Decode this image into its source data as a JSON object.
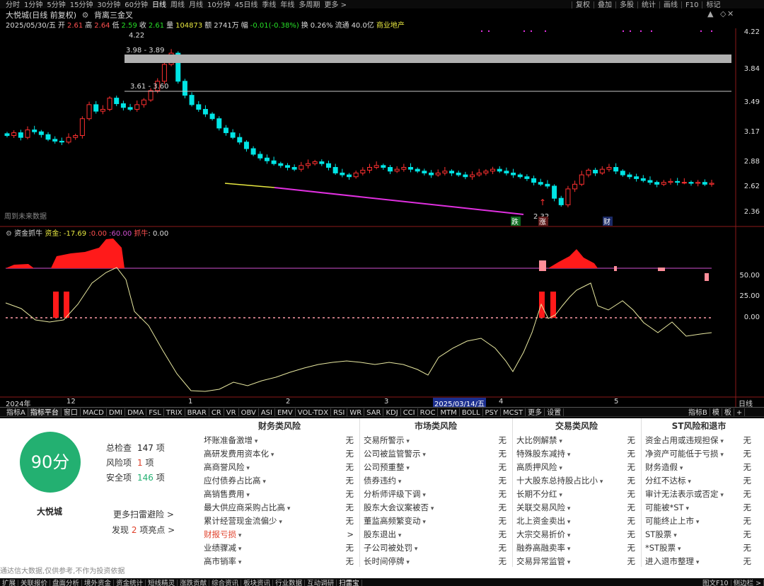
{
  "topbar": {
    "periods": [
      "分时",
      "1分钟",
      "5分钟",
      "15分钟",
      "30分钟",
      "60分钟",
      "日线",
      "周线",
      "月线",
      "10分钟",
      "45日线",
      "季线",
      "年线",
      "多周期",
      "更多 >"
    ],
    "active": "日线",
    "right_tools": [
      "复权",
      "叠加",
      "多股",
      "统计",
      "画线",
      "F10",
      "标记"
    ]
  },
  "header": {
    "stock": "大悦城(日线 前复权)",
    "mode_icon": "gear-icon",
    "strategy": "背离三金叉",
    "date": "2025/05/30/五",
    "open_label": "开",
    "open": "2.61",
    "high_label": "高",
    "high": "2.64",
    "low_label": "低",
    "low": "2.59",
    "close_label": "收",
    "close": "2.61",
    "volume_label": "量",
    "volume": "104873",
    "amount_label": "额",
    "amount": "2741万",
    "change_label": "幅",
    "change": "-0.01(-0.38%)",
    "turnover_label": "换",
    "turnover": "0.26%",
    "float_label": "流通",
    "float": "40.0亿",
    "sector": "商业地产"
  },
  "price_axis": {
    "labels": [
      "4.22",
      "3.84",
      "3.49",
      "3.17",
      "2.88",
      "2.62",
      "2.36"
    ]
  },
  "chart_data": {
    "type": "candlestick",
    "title": "大悦城(日线 前复权)",
    "x_month_labels": [
      "2024年",
      "12",
      "1",
      "2",
      "3",
      "2025/03/14/五",
      "4",
      "5"
    ],
    "price_ylim": [
      2.25,
      4.3
    ],
    "high_mark": "4.22",
    "low_mark": "2.32",
    "annotations": [
      "3.98 - 3.89",
      "3.61 - 3.60"
    ],
    "events": [
      "跌",
      "涨",
      "财"
    ],
    "footnote": "周到未来数据",
    "indicator": {
      "name": "资金抓牛",
      "fund_label": "资金",
      "fund_value": "-17.69",
      "level_a": "0.00",
      "level_b": "60.00",
      "bull_label": "抓牛",
      "bull_value": "0.00",
      "axis_labels": [
        "50.00",
        "25.00",
        "0.00"
      ]
    }
  },
  "tabs": {
    "items": [
      "指标A",
      "指标平台",
      "窗口",
      "MACD",
      "DMI",
      "DMA",
      "FSL",
      "TRIX",
      "BRAR",
      "CR",
      "VR",
      "OBV",
      "ASI",
      "EMV",
      "VOL-TDX",
      "RSI",
      "WR",
      "SAR",
      "KDJ",
      "CCI",
      "ROC",
      "MTM",
      "BOLL",
      "PSY",
      "MCST",
      "更多",
      "设置"
    ],
    "right": [
      "指标B",
      "模",
      "板",
      "+"
    ]
  },
  "panel": {
    "score": "90分",
    "company": "大悦城",
    "total_label": "总检查",
    "total": "147",
    "unit": "项",
    "risk_label": "风险项",
    "risk": "1",
    "safe_label": "安全项",
    "safe": "146",
    "more_link": "更多扫雷避险 >",
    "found_prefix": "发现",
    "found": "2",
    "found_suffix": "项亮点 >",
    "disclaimer": "通达信大数据,仅供参考,不作为投资依据",
    "columns": [
      {
        "title": "财务类风险",
        "rows": [
          {
            "label": "坏账准备激增",
            "value": "无"
          },
          {
            "label": "高研发费用资本化",
            "value": "无"
          },
          {
            "label": "高商誉风险",
            "value": "无"
          },
          {
            "label": "应付债券占比高",
            "value": "无"
          },
          {
            "label": "高销售费用",
            "value": "无"
          },
          {
            "label": "最大供应商采购占比高",
            "value": "无"
          },
          {
            "label": "累计经营现金流偏少",
            "value": "无"
          },
          {
            "label": "财报亏损",
            "value": ">",
            "warn": true
          },
          {
            "label": "业绩骤减",
            "value": "无"
          },
          {
            "label": "高市销率",
            "value": "无"
          }
        ]
      },
      {
        "title": "市场类风险",
        "rows": [
          {
            "label": "交易所警示",
            "value": "无"
          },
          {
            "label": "公司被监管警示",
            "value": "无"
          },
          {
            "label": "公司预重整",
            "value": "无"
          },
          {
            "label": "债券违约",
            "value": "无"
          },
          {
            "label": "分析师评级下调",
            "value": "无"
          },
          {
            "label": "股东大会议案被否",
            "value": "无"
          },
          {
            "label": "董监高频繁变动",
            "value": "无"
          },
          {
            "label": "股东退出",
            "value": "无"
          },
          {
            "label": "子公司被处罚",
            "value": "无"
          },
          {
            "label": "长时间停牌",
            "value": "无"
          }
        ]
      },
      {
        "title": "交易类风险",
        "rows": [
          {
            "label": "大比例解禁",
            "value": "无"
          },
          {
            "label": "特殊股东减持",
            "value": "无"
          },
          {
            "label": "高质押风险",
            "value": "无"
          },
          {
            "label": "十大股东总持股占比小",
            "value": "无"
          },
          {
            "label": "长期不分红",
            "value": "无"
          },
          {
            "label": "关联交易风险",
            "value": "无"
          },
          {
            "label": "北上资金卖出",
            "value": "无"
          },
          {
            "label": "大宗交易折价",
            "value": "无"
          },
          {
            "label": "融券高融卖率",
            "value": "无"
          },
          {
            "label": "交易异常监管",
            "value": "无"
          }
        ]
      },
      {
        "title": "ST风险和退市",
        "rows": [
          {
            "label": "资金占用或违规担保",
            "value": "无"
          },
          {
            "label": "净资产可能低于亏损",
            "value": "无"
          },
          {
            "label": "财务造假",
            "value": "无"
          },
          {
            "label": "分红不达标",
            "value": "无"
          },
          {
            "label": "审计无法表示或否定",
            "value": "无"
          },
          {
            "label": "可能被*ST",
            "value": "无"
          },
          {
            "label": "可能终止上市",
            "value": "无"
          },
          {
            "label": "ST股票",
            "value": "无"
          },
          {
            "label": "*ST股票",
            "value": "无"
          },
          {
            "label": "进入退市整理",
            "value": "无"
          }
        ]
      }
    ]
  },
  "bottom_bar": {
    "items": [
      "扩展",
      "关联报价",
      "盘面分析",
      "境外资金",
      "资金统计",
      "短线精灵",
      "涨跌贡献",
      "综合资讯",
      "板块资讯",
      "行业数据",
      "互动调研",
      "扫雷宝"
    ],
    "right": [
      "图文F10",
      "侧边栏 >"
    ]
  },
  "colors": {
    "up": "#ff3030",
    "down": "#00e5e5",
    "panel_bg": "#ffffff",
    "score": "#23b071",
    "warn": "#e0402a"
  }
}
